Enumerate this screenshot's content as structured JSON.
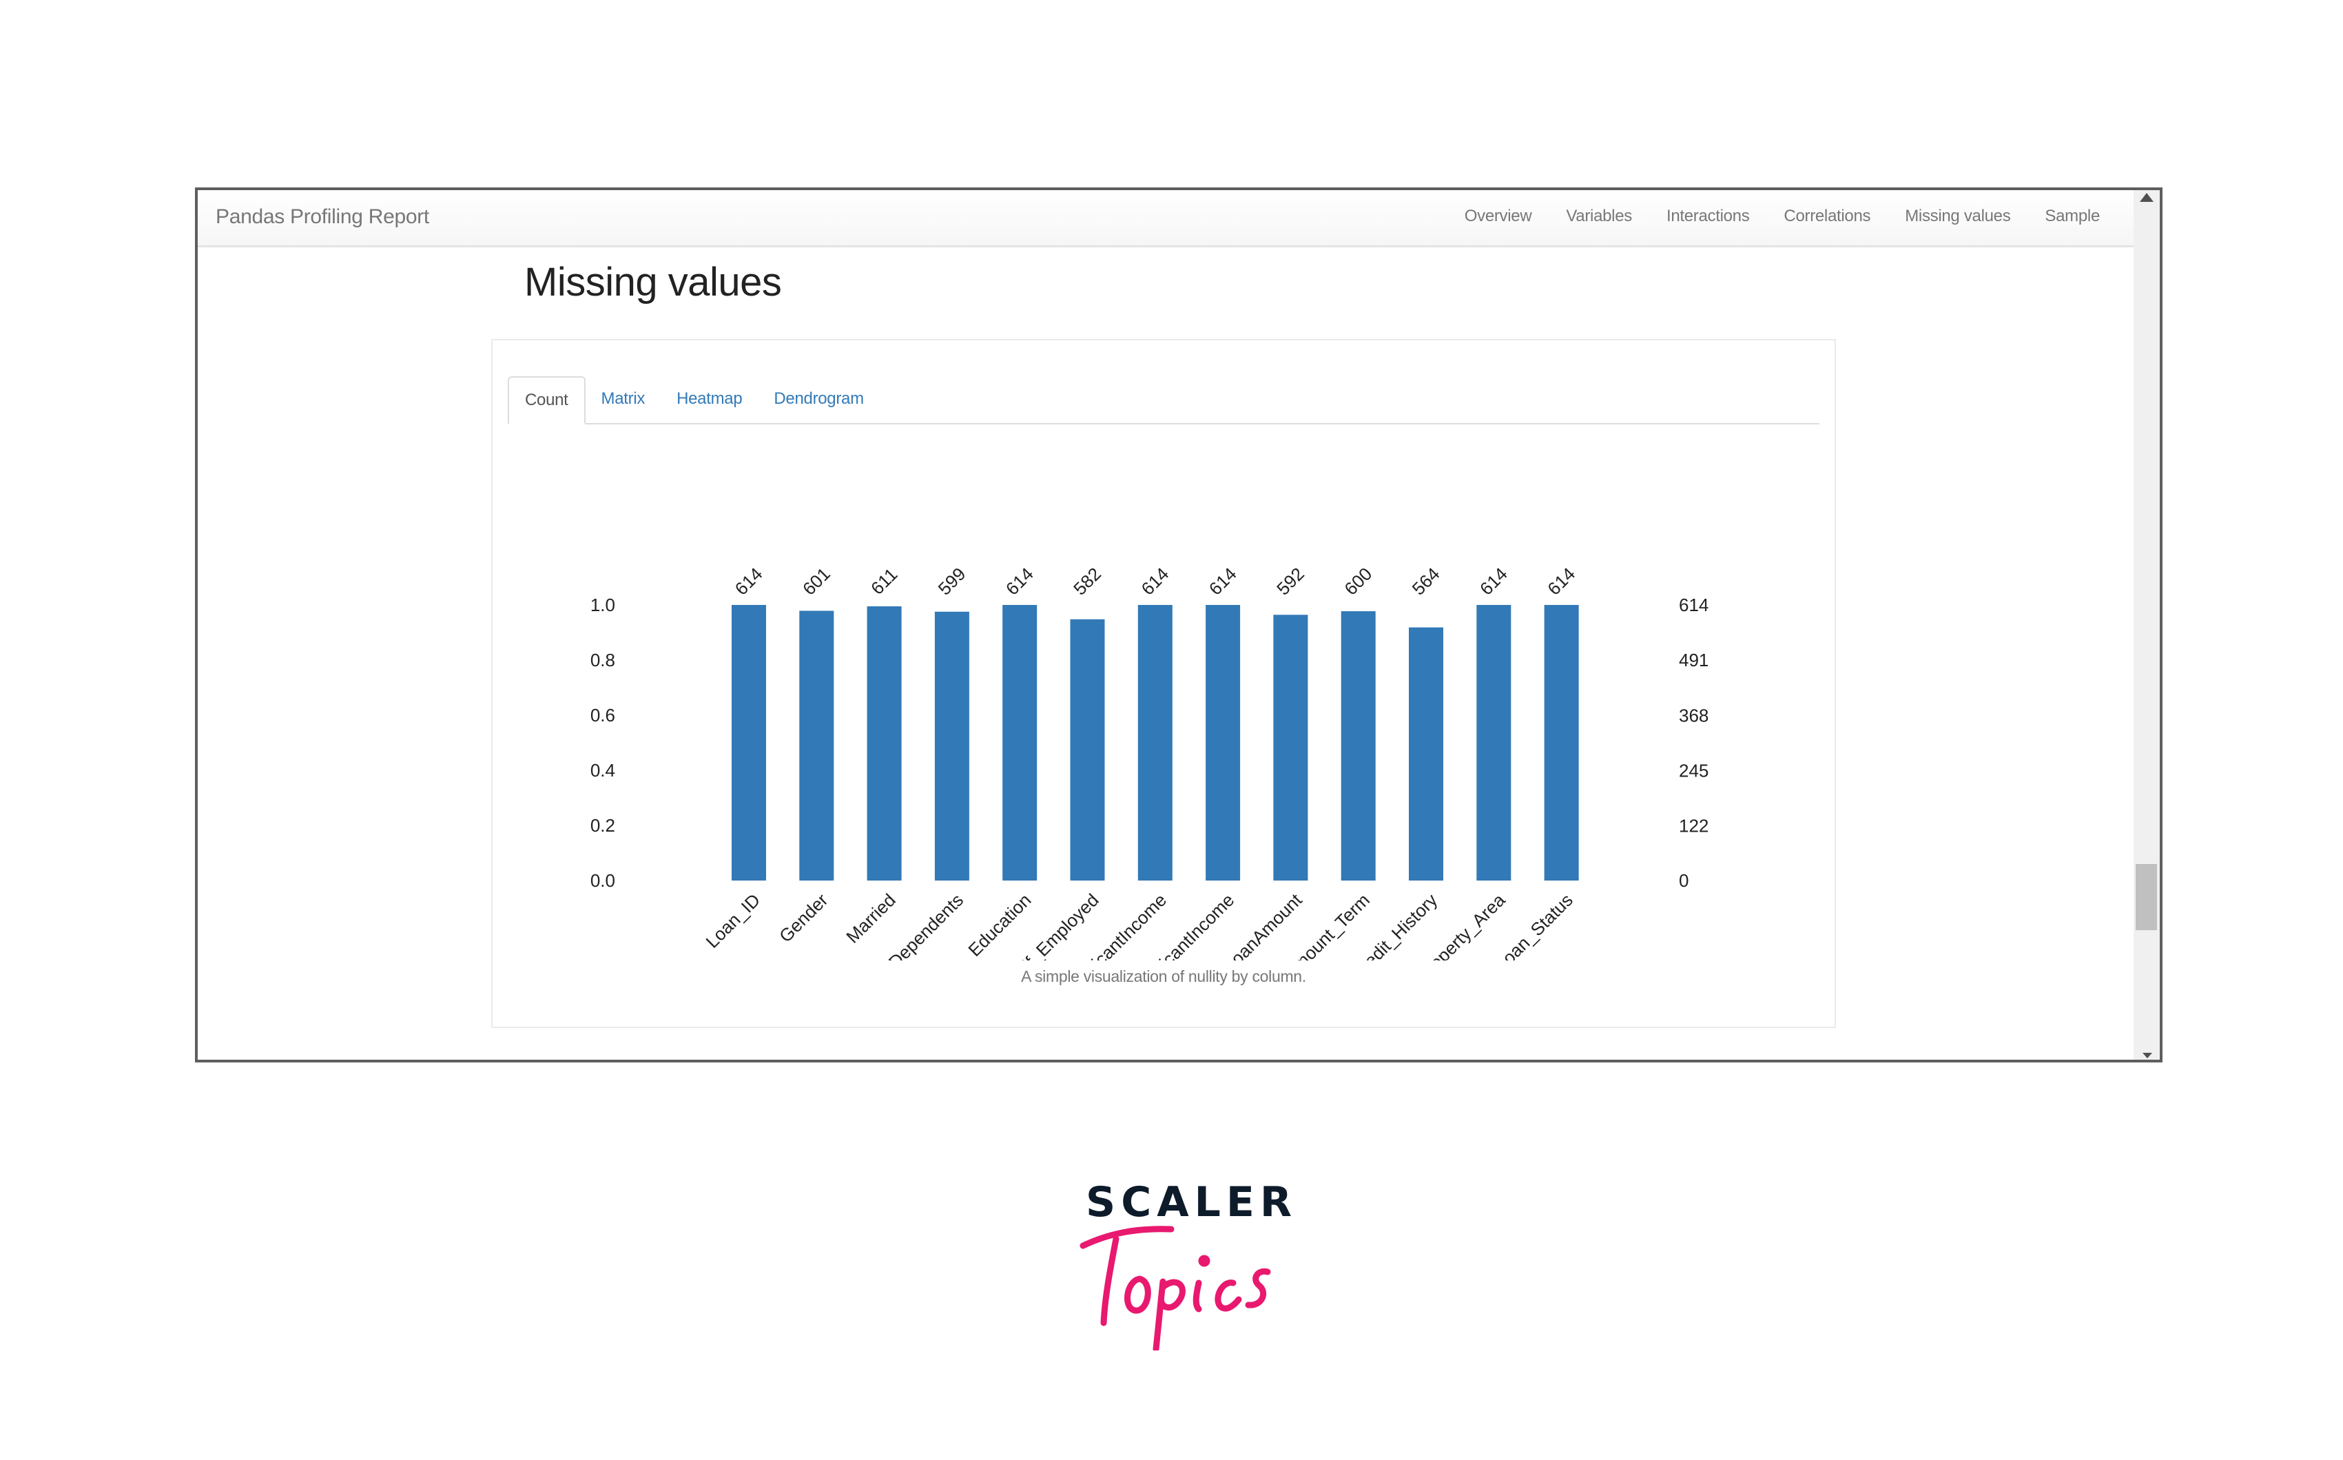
{
  "navbar": {
    "brand": "Pandas Profiling Report",
    "links": [
      "Overview",
      "Variables",
      "Interactions",
      "Correlations",
      "Missing values",
      "Sample"
    ]
  },
  "scrollbar": {
    "up_icon": "triangle-up-icon",
    "down_icon": "triangle-down-icon"
  },
  "section": {
    "title": "Missing values",
    "tabs": [
      {
        "label": "Count",
        "active": true
      },
      {
        "label": "Matrix",
        "active": false
      },
      {
        "label": "Heatmap",
        "active": false
      },
      {
        "label": "Dendrogram",
        "active": false
      }
    ],
    "caption": "A simple visualization of nullity by column."
  },
  "colors": {
    "bar": "#3279b7",
    "link": "#337ab7",
    "logo_dark": "#0d1b2a",
    "logo_pink": "#e8196f"
  },
  "chart_data": {
    "type": "bar",
    "title": "",
    "xlabel": "",
    "ylabel": "",
    "categories": [
      "Loan_ID",
      "Gender",
      "Married",
      "Dependents",
      "Education",
      "Self_Employed",
      "ApplicantIncome",
      "CoapplicantIncome",
      "LoanAmount",
      "Loan_Amount_Term",
      "Credit_History",
      "Property_Area",
      "Loan_Status"
    ],
    "values": [
      614,
      601,
      611,
      599,
      614,
      582,
      614,
      614,
      592,
      600,
      564,
      614,
      614
    ],
    "total": 614,
    "ylim": [
      0,
      1.0
    ],
    "left_ticks": [
      "0.0",
      "0.2",
      "0.4",
      "0.6",
      "0.8",
      "1.0"
    ],
    "left_tick_values": [
      0.0,
      0.2,
      0.4,
      0.6,
      0.8,
      1.0
    ],
    "right_ticks": [
      "0",
      "122",
      "245",
      "368",
      "491",
      "614"
    ],
    "right_tick_values": [
      0,
      122,
      245,
      368,
      491,
      614
    ],
    "grid": false,
    "legend": "none"
  },
  "logo": {
    "line1": "SCALER",
    "line2": "Topics"
  }
}
